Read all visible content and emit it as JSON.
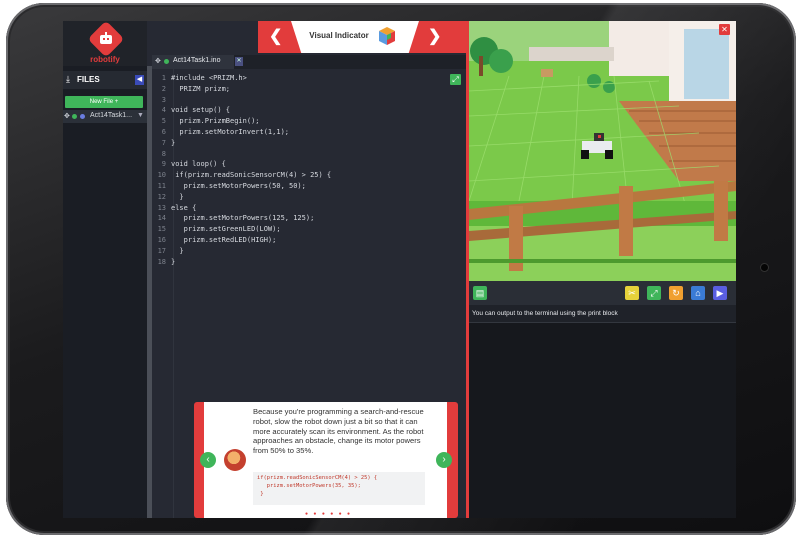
{
  "app": {
    "logo_text": "robotify"
  },
  "sidebar": {
    "files_label": "FILES",
    "new_file_label": "New File +",
    "file_item": "Act14Task1..."
  },
  "editor": {
    "tab_name": "Act14Task1.ino",
    "lines": [
      {
        "n": "1",
        "t": "#include <PRIZM.h>"
      },
      {
        "n": "2",
        "t": "  PRIZM prizm;"
      },
      {
        "n": "3",
        "t": ""
      },
      {
        "n": "4",
        "t": "void setup() {"
      },
      {
        "n": "5",
        "t": "  prizm.PrizmBegin();"
      },
      {
        "n": "6",
        "t": "  prizm.setMotorInvert(1,1);"
      },
      {
        "n": "7",
        "t": "}"
      },
      {
        "n": "8",
        "t": ""
      },
      {
        "n": "9",
        "t": "void loop() {"
      },
      {
        "n": "10",
        "t": " if(prizm.readSonicSensorCM(4) > 25) {"
      },
      {
        "n": "11",
        "t": "   prizm.setMotorPowers(50, 50);"
      },
      {
        "n": "12",
        "t": "  }"
      },
      {
        "n": "13",
        "t": "else {"
      },
      {
        "n": "14",
        "t": "   prizm.setMotorPowers(125, 125);"
      },
      {
        "n": "15",
        "t": "   prizm.setGreenLED(LOW);"
      },
      {
        "n": "16",
        "t": "   prizm.setRedLED(HIGH);"
      },
      {
        "n": "17",
        "t": "  }"
      },
      {
        "n": "18",
        "t": "}"
      }
    ]
  },
  "header": {
    "title": "Visual Indicator"
  },
  "terminal": {
    "message": "You can output to the terminal using the print block"
  },
  "tutorial": {
    "text": "Because you're programming a search-and-rescue robot, slow the robot down just a bit so that it can more accurately scan its environment. As the robot approaches an obstacle, change its motor powers from 50% to 35%.",
    "code": "if(prizm.readSonicSensorCM(4) > 25) {\n   prizm.setMotorPowers(35, 35);\n }",
    "dots": "● ● ● ● ● ●"
  },
  "colors": {
    "accent_red": "#e23c3c",
    "accent_green": "#3fb55a",
    "accent_yellow": "#e6d23a",
    "accent_orange": "#f0a030",
    "accent_blue": "#3a7bd5",
    "accent_purple": "#5a5ee0"
  },
  "icons": {
    "toolbar": [
      "document-icon",
      "compress-icon",
      "fullscreen-icon",
      "reset-icon",
      "home-icon",
      "play-icon"
    ]
  }
}
